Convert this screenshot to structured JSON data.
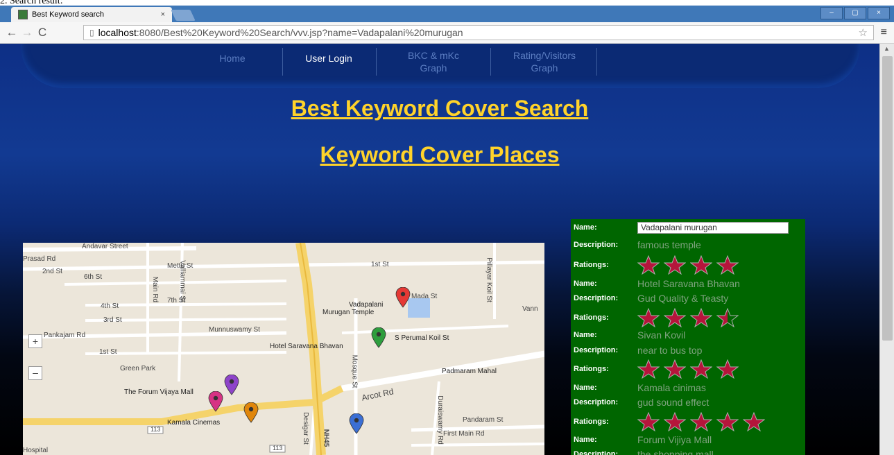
{
  "doc_caption": "2.    Search result:",
  "browser": {
    "tab_title": "Best Keyword search",
    "tab_close": "×",
    "url_host": "localhost",
    "url_rest": ":8080/Best%20Keyword%20Search/vvv.jsp?name=Vadapalani%20murugan",
    "window_buttons": [
      "–",
      "▢",
      "×"
    ]
  },
  "nav": {
    "home": "Home",
    "user_login": "User Login",
    "bkc_line1": "BKC & mKc",
    "bkc_line2": "Graph",
    "rating_line1": "Rating/Visitors",
    "rating_line2": "Graph"
  },
  "titles": {
    "main": "Best Keyword Cover Search",
    "sub": "Keyword Cover Places"
  },
  "map": {
    "labels": [
      "Andavar Street",
      "Prasad Rd",
      "2nd St",
      "6th St",
      "Mettu St",
      "Main Rd",
      "7th St",
      "4th St",
      "3rd St",
      "Valliammai St",
      "1st St",
      "Pillayar Koil St",
      "Mada St",
      "Vadapalani",
      "Murugan Temple",
      "Vann",
      "Munnuswamy St",
      "Pankajam Rd",
      "S Perumal Koil St",
      "Hotel Saravana Bhavan",
      "1st St",
      "Green Park",
      "Padmaram Mahal",
      "The Forum Vijaya Mall",
      "Arcot Rd",
      "Kamala Cinemas",
      "Pandaram St",
      "First Main Rd",
      "Hospital",
      "NH45",
      "Desigar St",
      "Mosque St",
      "Duraiswamy Rd",
      "113",
      "113"
    ],
    "pin_colors": [
      "#e53935",
      "#2e9e3e",
      "#8e44c9",
      "#d63384",
      "#e0860b",
      "#3b6fd4"
    ]
  },
  "labels": {
    "name": "Name:",
    "description": "Description:",
    "ratings": "Rationgs:"
  },
  "results": [
    {
      "name": "Vadapalani murugan",
      "description": "famous temple",
      "stars": 4
    },
    {
      "name": "Hotel Saravana Bhavan",
      "description": "Gud Quality & Teasty",
      "stars": 3.5
    },
    {
      "name": "Sivan Kovil",
      "description": "near to bus top",
      "stars": 4
    },
    {
      "name": "Kamala cinimas",
      "description": "gud sound effect",
      "stars": 5
    },
    {
      "name": "Forum Vijiya Mall",
      "description": "the shopping mall"
    }
  ],
  "colors": {
    "title": "#ffd32a",
    "panel": "#006600",
    "star": "#b5153b",
    "star_outline": "#b0b0b0"
  }
}
